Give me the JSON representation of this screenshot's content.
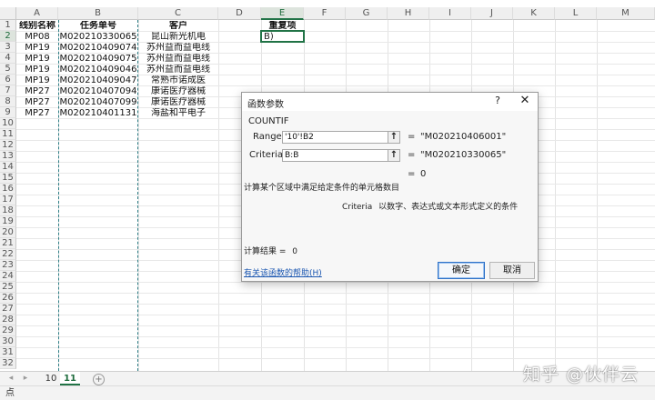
{
  "spreadsheet": {
    "columns": [
      "A",
      "B",
      "C",
      "D",
      "E",
      "F",
      "G",
      "H",
      "I",
      "J",
      "K",
      "L",
      "M"
    ],
    "selected_column": "E",
    "rows": [
      "1",
      "2",
      "3",
      "4",
      "5",
      "6",
      "7",
      "8",
      "9",
      "10",
      "11",
      "12",
      "13",
      "14",
      "15",
      "16",
      "17",
      "18",
      "19",
      "20",
      "21",
      "22",
      "23",
      "24",
      "25",
      "26",
      "27",
      "28",
      "29",
      "30",
      "31",
      "32"
    ],
    "selected_row": "2",
    "headers": {
      "a": "线别名称",
      "b": "任务单号",
      "c": "客户",
      "e": "重复项"
    },
    "data": [
      {
        "a": "MP08",
        "b": "M020210330065",
        "c": "昆山新光机电"
      },
      {
        "a": "MP19",
        "b": "M020210409074",
        "c": "苏州益而益电线"
      },
      {
        "a": "MP19",
        "b": "M020210409075",
        "c": "苏州益而益电线"
      },
      {
        "a": "MP19",
        "b": "M020210409046",
        "c": "苏州益而益电线"
      },
      {
        "a": "MP19",
        "b": "M020210409047",
        "c": "常熟市诺成医"
      },
      {
        "a": "MP27",
        "b": "M020210407094",
        "c": "康诺医疗器械"
      },
      {
        "a": "MP27",
        "b": "M020210407099",
        "c": "康诺医疗器械"
      },
      {
        "a": "MP27",
        "b": "M020210401131",
        "c": "海盐和平电子"
      }
    ],
    "active_cell_value": "B)"
  },
  "tabs": {
    "sheet1": "10",
    "sheet2": "11",
    "add": "+",
    "prev": "◂",
    "next": "▸"
  },
  "status": {
    "mode": "点"
  },
  "watermark": "知乎 @伙伴云",
  "dialog": {
    "title": "函数参数",
    "help_glyph": "?",
    "close_glyph": "✕",
    "function_name": "COUNTIF",
    "args": [
      {
        "label": "Range",
        "value": "'10'!B2",
        "result": "\"M020210406001\""
      },
      {
        "label": "Criteria",
        "value": "B:B",
        "result": "\"M020210330065\""
      }
    ],
    "eq_sign": "=",
    "formula_result": "0",
    "description": "计算某个区域中满足给定条件的单元格数目",
    "arg_description_label": "Criteria",
    "arg_description": "以数字、表达式或文本形式定义的条件",
    "calc_result_label": "计算结果 =",
    "calc_result_value": "0",
    "help_link": "有关该函数的帮助(H)",
    "ok": "确定",
    "cancel": "取消"
  },
  "colors": {
    "accent": "#217346",
    "link": "#1a56b0",
    "dashed_border": "#2f7f86"
  }
}
